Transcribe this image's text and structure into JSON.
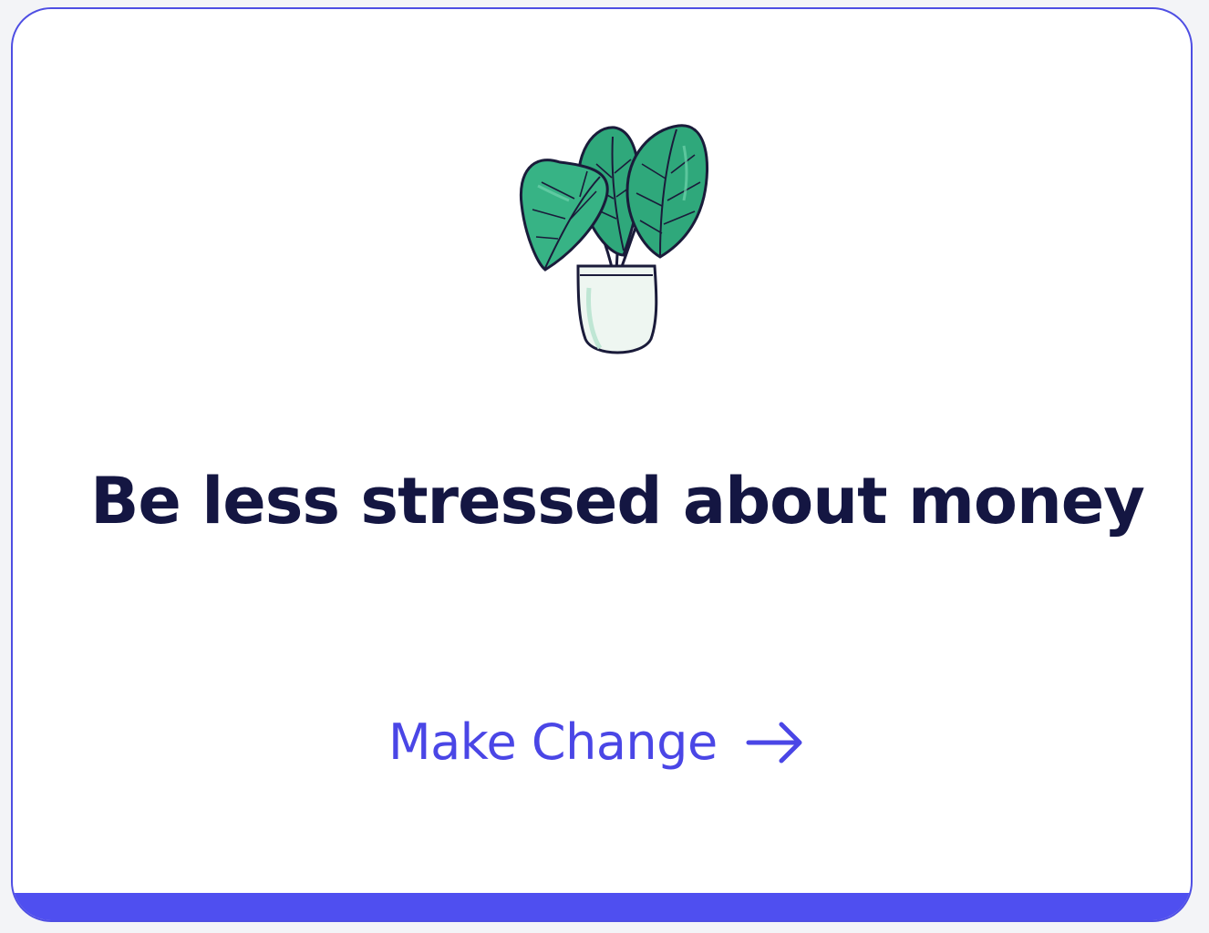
{
  "card": {
    "headline": "Be less stressed about money",
    "cta_label": "Make Change",
    "illustration": "potted-plant",
    "cta_icon": "arrow-right-icon"
  },
  "colors": {
    "page_background": "#f3f4f7",
    "card_background": "#ffffff",
    "card_border": "#4e4ee3",
    "bottom_accent": "#4f4ff0",
    "headline": "#141642",
    "cta": "#4a46e6",
    "leaf": "#2fa87b",
    "leaf_light": "#6fd3ad",
    "pot": "#eef6f1",
    "outline": "#1a1b3a"
  }
}
